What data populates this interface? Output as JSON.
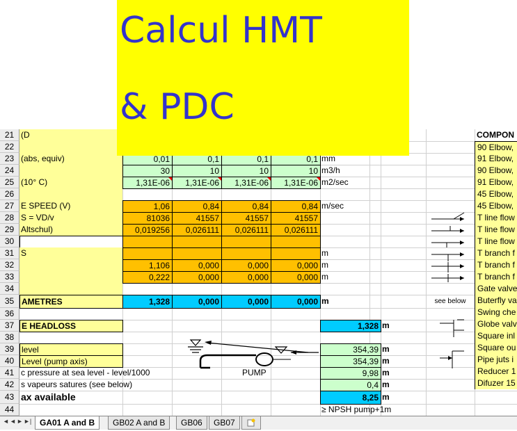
{
  "banner": {
    "line1": "Calcul HMT",
    "line2": "& PDC"
  },
  "rows": {
    "r21": {
      "num": "21",
      "label": "(D"
    },
    "r22": {
      "num": "22"
    },
    "r23": {
      "num": "23",
      "label": "(abs, equiv)",
      "v1": "0,01",
      "v2": "0,1",
      "v3": "0,1",
      "v4": "0,1",
      "unit": "mm"
    },
    "r24": {
      "num": "24",
      "v1": "30",
      "v2": "10",
      "v3": "10",
      "v4": "10",
      "unit": "m3/h"
    },
    "r25": {
      "num": "25",
      "label": "(10° C)",
      "v1": "1,31E-06",
      "v2": "1,31E-06",
      "v3": "1,31E-06",
      "v4": "1,31E-06",
      "unit": "m2/sec"
    },
    "r26": {
      "num": "26"
    },
    "r27": {
      "num": "27",
      "label": "E SPEED (V)",
      "v1": "1,06",
      "v2": "0,84",
      "v3": "0,84",
      "v4": "0,84",
      "unit": "m/sec"
    },
    "r28": {
      "num": "28",
      "label": "S = VD/v",
      "v1": "81036",
      "v2": "41557",
      "v3": "41557",
      "v4": "41557"
    },
    "r29": {
      "num": "29",
      "label": "Altschul)",
      "v1": "0,019256",
      "v2": "0,026111",
      "v3": "0,026111",
      "v4": "0,026111"
    },
    "r30": {
      "num": "30"
    },
    "r31": {
      "num": "31",
      "label": "S",
      "unit": "m"
    },
    "r32": {
      "num": "32",
      "v1": "1,106",
      "v2": "0,000",
      "v3": "0,000",
      "v4": "0,000",
      "unit": "m"
    },
    "r33": {
      "num": "33",
      "v1": "0,222",
      "v2": "0,000",
      "v3": "0,000",
      "v4": "0,000",
      "unit": "m"
    },
    "r34": {
      "num": "34"
    },
    "r35": {
      "num": "35",
      "label": "AMETRES",
      "v1": "1,328",
      "v2": "0,000",
      "v3": "0,000",
      "v4": "0,000",
      "unit": "m",
      "note": "see below"
    },
    "r36": {
      "num": "36"
    },
    "r37": {
      "num": "37",
      "label": "E HEADLOSS",
      "value": "1,328",
      "unit": "m"
    },
    "r38": {
      "num": "38"
    },
    "r39": {
      "num": "39",
      "label": "level",
      "value": "354,39",
      "unit": "m"
    },
    "r40": {
      "num": "40",
      "label": "Level (pump axis)",
      "value": "354,39",
      "unit": "m"
    },
    "r41": {
      "num": "41",
      "label": "c pressure at sea level - level/1000",
      "value": "9,98",
      "unit": "m"
    },
    "r42": {
      "num": "42",
      "label": "s vapeurs satures (see below)",
      "value": "0,4",
      "unit": "m"
    },
    "r43": {
      "num": "43",
      "label": "ax available",
      "value": "8,25",
      "unit": "m"
    },
    "r44": {
      "num": "44",
      "note": "≥ NPSH pump+1m"
    }
  },
  "diagram": {
    "pump_label": "PUMP"
  },
  "components": {
    "header": "COMPON",
    "items": [
      "90 Elbow,",
      "91 Elbow,",
      "90 Elbow,",
      "91 Elbow,",
      "45 Elbow,",
      "45 Elbow,",
      "T line flow",
      "T line flow",
      "T line flow",
      "T branch f",
      "T branch f",
      "T branch f",
      "Gate valve",
      "Buterfly va",
      "Swing che",
      "Globe valv",
      "Square inl",
      "Square ou",
      "Pipe juts i",
      "Reducer 1",
      "Difuzer 15"
    ]
  },
  "tabs": [
    {
      "label": "GA01 A and B",
      "active": true
    },
    {
      "label": "GB02 A and B",
      "active": false
    },
    {
      "label": "GB06",
      "active": false
    },
    {
      "label": "GB07",
      "active": false
    }
  ],
  "colors": {
    "banner": "#ffff00",
    "banner_text": "#3333cc",
    "yellow": "#ffff99",
    "green": "#ccffcc",
    "orange": "#ffc000",
    "cyan": "#00ccff"
  }
}
